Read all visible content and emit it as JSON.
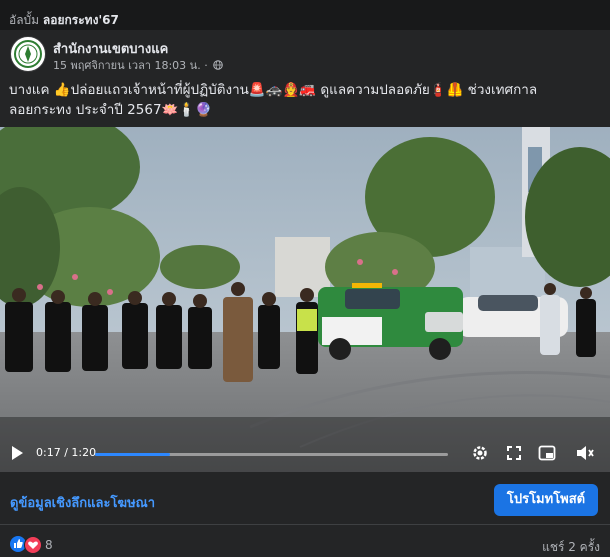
{
  "album": {
    "prefix": "อัลบั้ม",
    "name": "ลอยกระทง'67"
  },
  "post": {
    "page_name": "สำนักงานเขตบางแค",
    "timestamp": "15 พฤศจิกายน เวลา 18:03 น. ·",
    "text_line1": "บางแค 👍ปล่อยแถวเจ้าหน้าที่ผู้ปฏิบัติงาน🚨🚓🧑‍🚒🚒 ดูแลความปลอดภัย🧯🦺 ช่วงเทศกาล",
    "text_line2": "ลอยกระทง ประจำปี 2567🪷🕯️🔮"
  },
  "video": {
    "current_time": "0:17",
    "duration": "1:20",
    "time_label": "0:17 / 1:20",
    "progress": 0.2125,
    "controls": [
      "play-icon",
      "settings-icon",
      "fullscreen-icon",
      "pip-icon",
      "volume-icon"
    ]
  },
  "actions": {
    "insights_link": "ดูข้อมูลเชิงลึกและโฆษณา",
    "promote_button": "โปรโมทโพสต์"
  },
  "footer": {
    "reaction_count": "8",
    "shares": "แชร์ 2 ครั้ง"
  },
  "colors": {
    "background": "#18191a",
    "card": "#242526",
    "accent": "#1b74e4",
    "link": "#4599ff",
    "like": "#1877f2",
    "love": "#f33e58"
  }
}
